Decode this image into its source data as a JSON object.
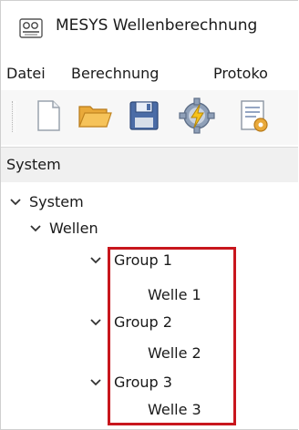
{
  "window": {
    "title": "MESYS Wellenberechnung"
  },
  "menu": {
    "items": [
      "Datei",
      "Berechnung",
      "Protoko"
    ]
  },
  "toolbar": {
    "tools": [
      "new-document-icon",
      "open-folder-icon",
      "save-disk-icon",
      "calculate-gear-icon",
      "report-icon"
    ]
  },
  "panel": {
    "title": "System"
  },
  "tree": {
    "root": "System",
    "wellen": "Wellen",
    "groups": [
      {
        "label": "Group 1",
        "child": "Welle 1"
      },
      {
        "label": "Group 2",
        "child": "Welle 2"
      },
      {
        "label": "Group 3",
        "child": "Welle 3"
      }
    ]
  },
  "colors": {
    "highlight": "#c8161d",
    "panel_header": "#f0f0f0"
  }
}
